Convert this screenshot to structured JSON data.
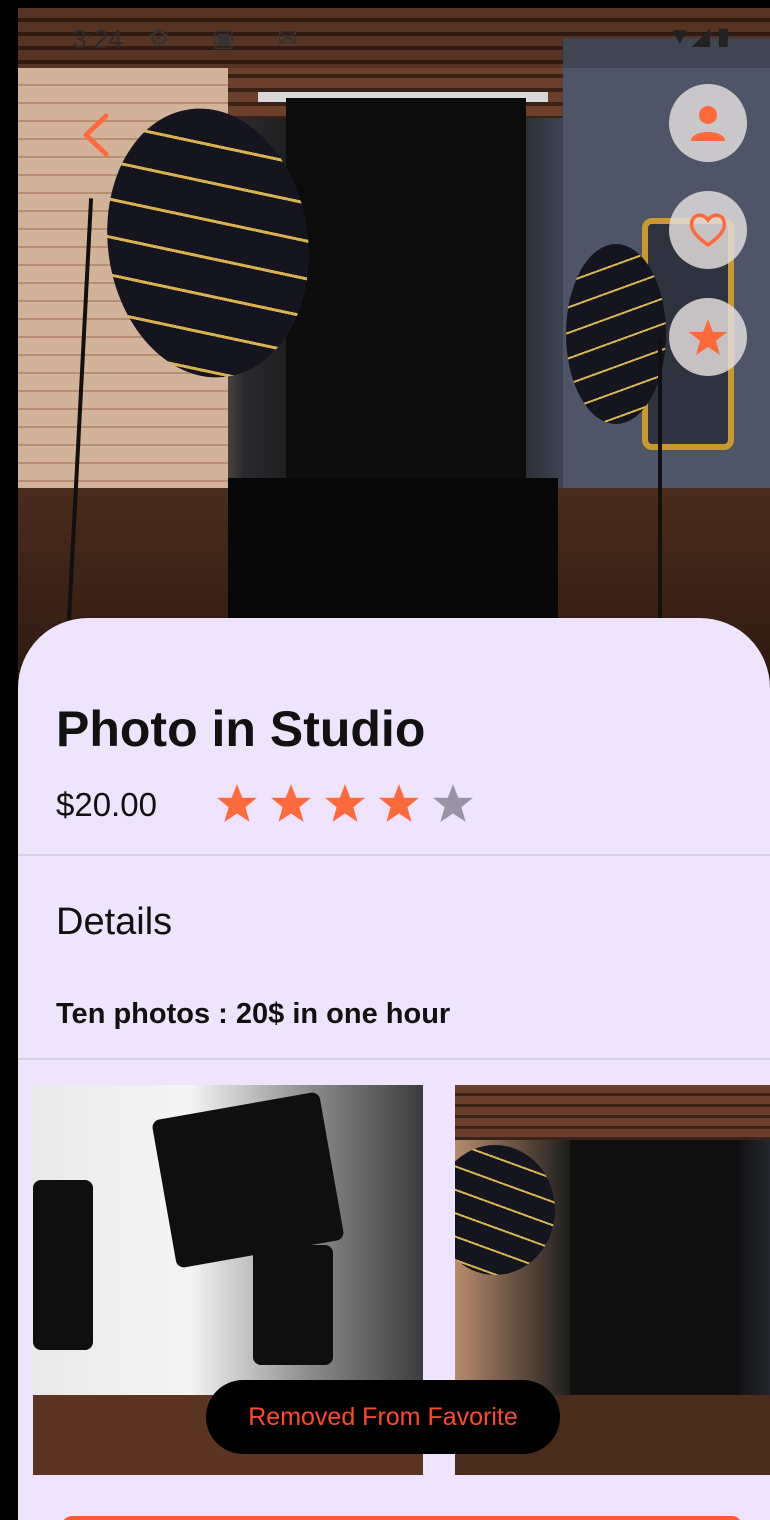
{
  "status_bar": {
    "time": "3:24"
  },
  "product": {
    "title": "Photo in Studio",
    "price": "$20.00",
    "rating": 4,
    "rating_max": 5
  },
  "details": {
    "heading": "Details",
    "text": "Ten photos : 20$ in one hour"
  },
  "toast": {
    "message": "Removed From Favorite"
  },
  "colors": {
    "accent": "#ff6a3d",
    "star_inactive": "#9a93a6",
    "sheet_bg": "#efe4fd"
  },
  "icons": {
    "back": "chevron-left-icon",
    "profile": "person-icon",
    "favorite": "heart-outline-icon",
    "rate": "star-icon"
  }
}
